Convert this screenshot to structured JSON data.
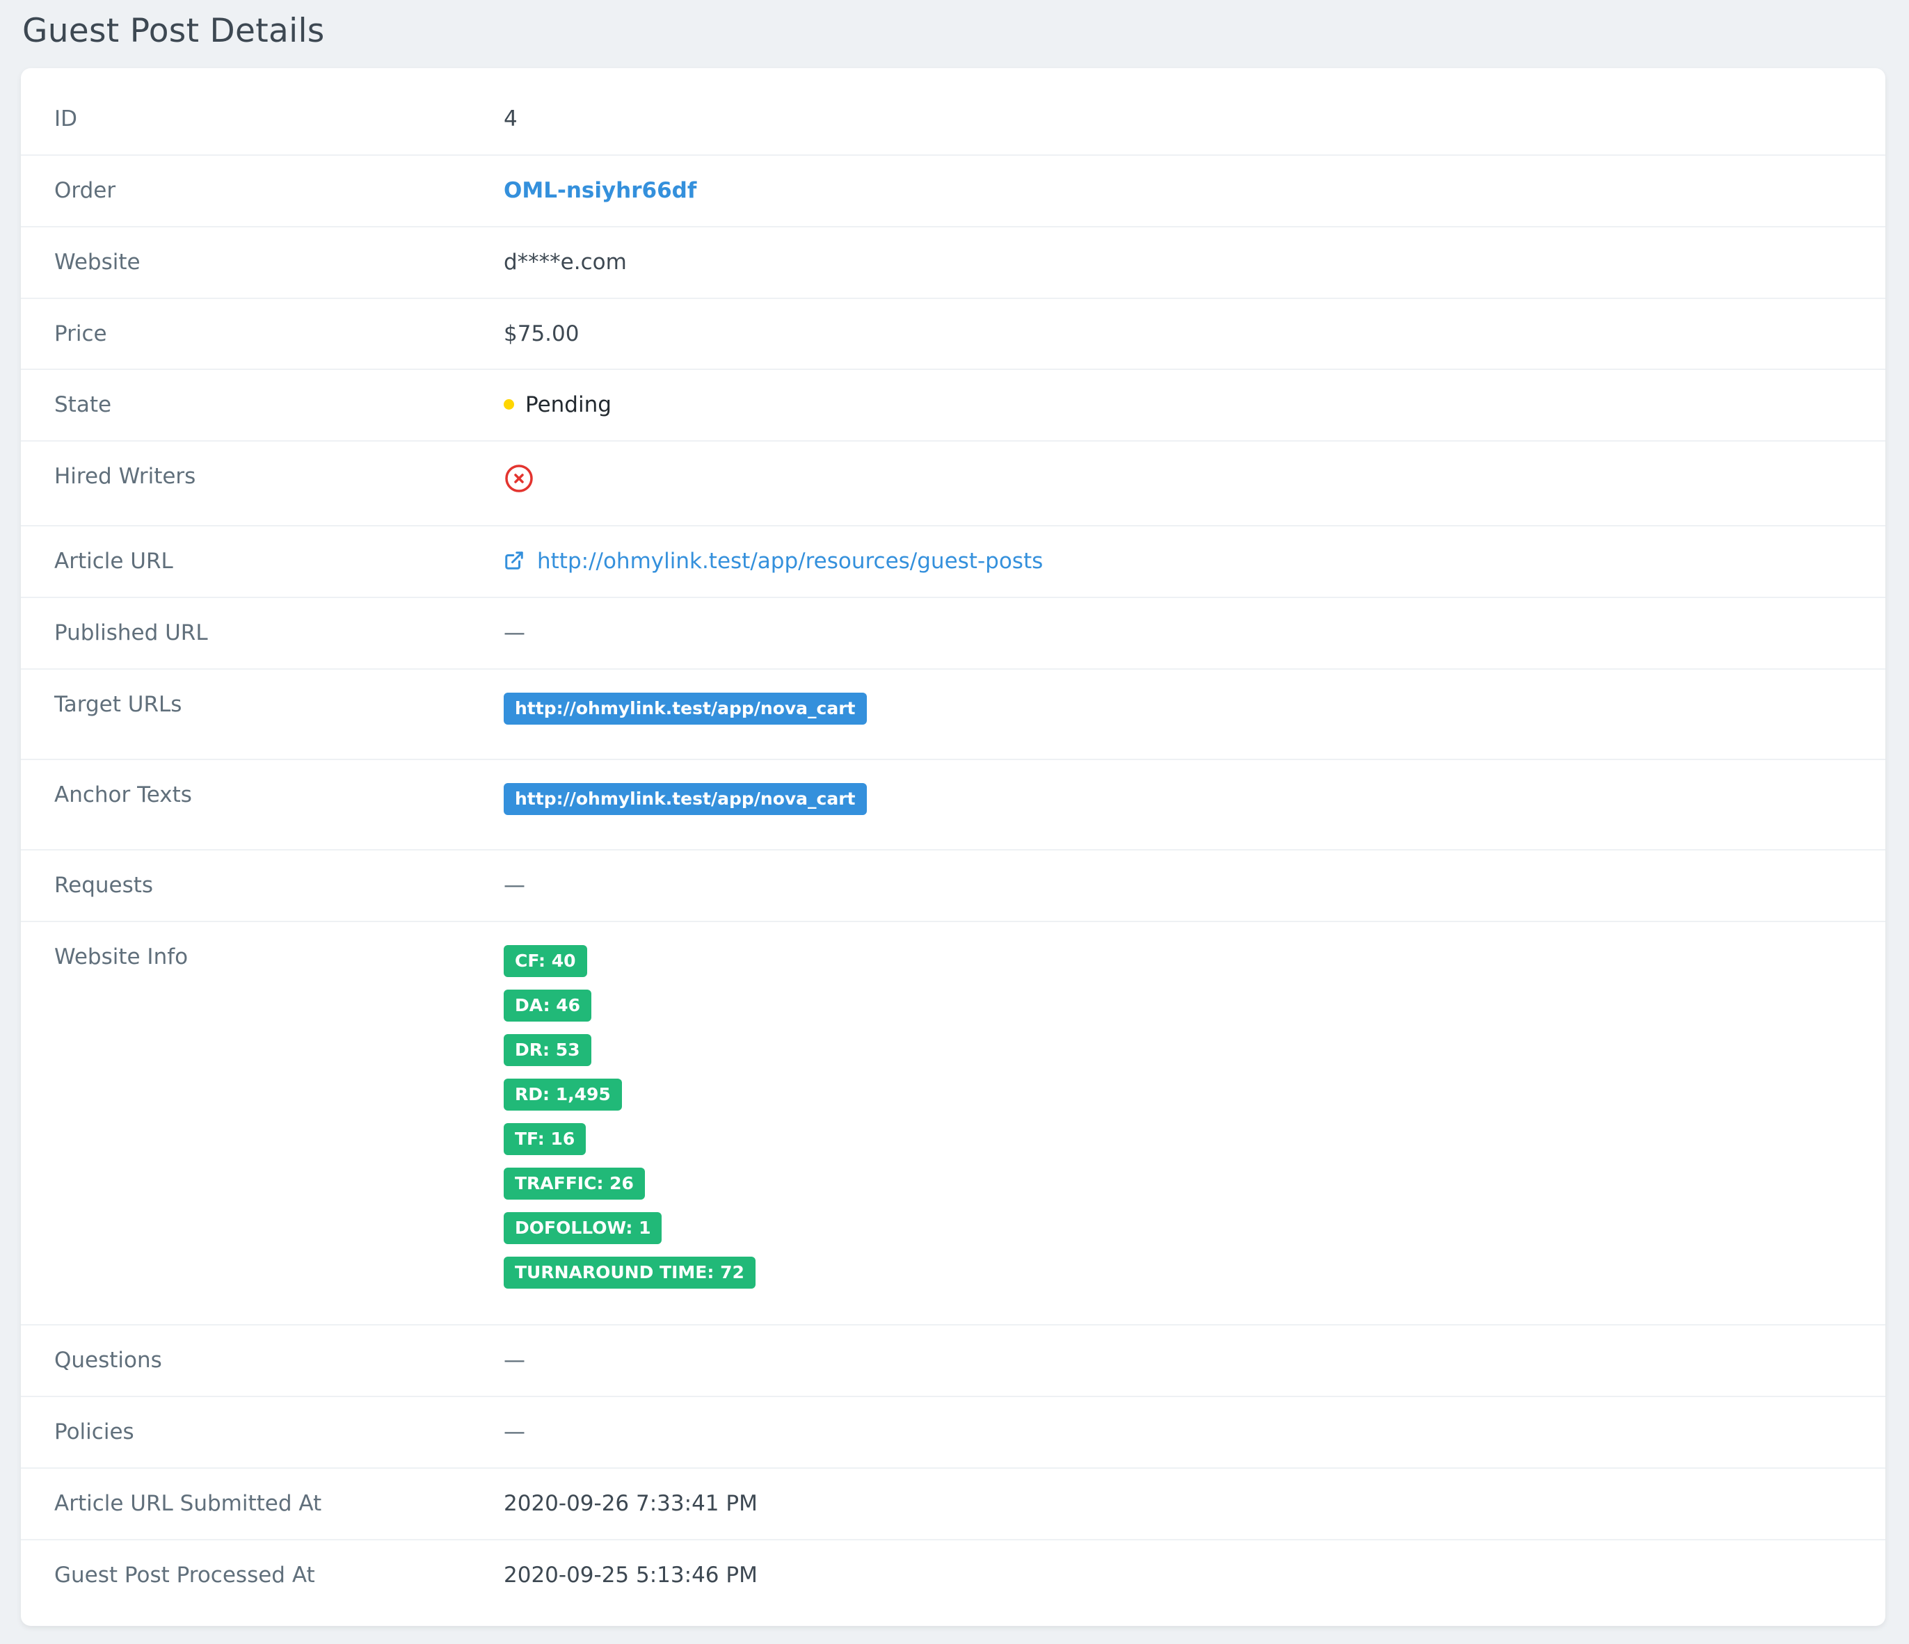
{
  "page": {
    "title": "Guest Post Details"
  },
  "colors": {
    "background": "#eef1f4",
    "link": "#3490dc",
    "pending_dot": "#ffd600",
    "badge_green": "#21b978",
    "error_red": "#e3342f"
  },
  "fields": {
    "id": {
      "label": "ID",
      "value": "4"
    },
    "order": {
      "label": "Order",
      "value": "OML-nsiyhr66df"
    },
    "website": {
      "label": "Website",
      "value": "d****e.com"
    },
    "price": {
      "label": "Price",
      "value": "$75.00"
    },
    "state": {
      "label": "State",
      "value": "Pending",
      "indicator": "yellow-dot"
    },
    "hired_writers": {
      "label": "Hired Writers",
      "icon": "x-circle-icon"
    },
    "article_url": {
      "label": "Article URL",
      "value": "http://ohmylink.test/app/resources/guest-posts",
      "icon": "external-link-icon"
    },
    "published_url": {
      "label": "Published URL",
      "value": "—"
    },
    "target_urls": {
      "label": "Target URLs",
      "tags": [
        "http://ohmylink.test/app/nova_cart"
      ]
    },
    "anchor_texts": {
      "label": "Anchor Texts",
      "tags": [
        "http://ohmylink.test/app/nova_cart"
      ]
    },
    "requests": {
      "label": "Requests",
      "value": "—"
    },
    "website_info": {
      "label": "Website Info",
      "badges": [
        "CF: 40",
        "DA: 46",
        "DR: 53",
        "RD: 1,495",
        "TF: 16",
        "TRAFFIC: 26",
        "DOFOLLOW: 1",
        "TURNAROUND TIME: 72"
      ]
    },
    "questions": {
      "label": "Questions",
      "value": "—"
    },
    "policies": {
      "label": "Policies",
      "value": "—"
    },
    "article_url_submitted_at": {
      "label": "Article URL Submitted At",
      "value": "2020-09-26 7:33:41 PM"
    },
    "guest_post_processed_at": {
      "label": "Guest Post Processed At",
      "value": "2020-09-25 5:13:46 PM"
    }
  }
}
